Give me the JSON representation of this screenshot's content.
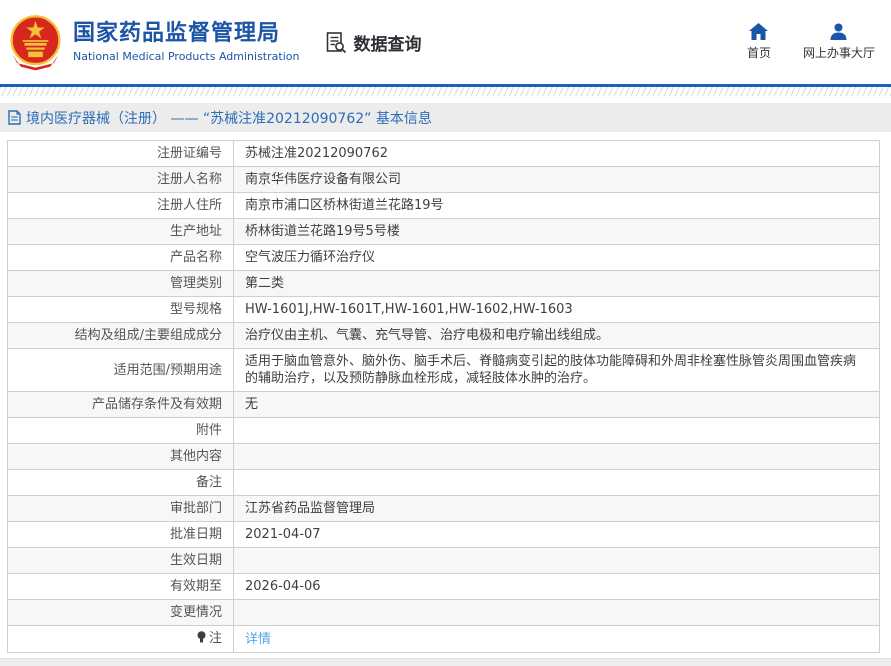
{
  "header": {
    "title": "国家药品监督管理局",
    "subtitle": "National Medical Products Administration",
    "nav_query": "数据查询",
    "nav_home": "首页",
    "nav_hall": "网上办事大厅"
  },
  "breadcrumb": {
    "text": "境内医疗器械（注册） —— “苏械注准20212090762” 基本信息"
  },
  "table": {
    "rows": [
      {
        "label": "注册证编号",
        "value": "苏械注准20212090762"
      },
      {
        "label": "注册人名称",
        "value": "南京华伟医疗设备有限公司"
      },
      {
        "label": "注册人住所",
        "value": "南京市浦口区桥林街道兰花路19号"
      },
      {
        "label": "生产地址",
        "value": "桥林街道兰花路19号5号楼"
      },
      {
        "label": "产品名称",
        "value": "空气波压力循环治疗仪"
      },
      {
        "label": "管理类别",
        "value": "第二类"
      },
      {
        "label": "型号规格",
        "value": "HW-1601J,HW-1601T,HW-1601,HW-1602,HW-1603"
      },
      {
        "label": "结构及组成/主要组成成分",
        "value": "治疗仪由主机、气囊、充气导管、治疗电极和电疗输出线组成。"
      },
      {
        "label": "适用范围/预期用途",
        "value": "适用于脑血管意外、脑外伤、脑手术后、脊髓病变引起的肢体功能障碍和外周非栓塞性脉管炎周围血管疾病的辅助治疗，以及预防静脉血栓形成，减轻肢体水肿的治疗。"
      },
      {
        "label": "产品储存条件及有效期",
        "value": "无"
      },
      {
        "label": "附件",
        "value": ""
      },
      {
        "label": "其他内容",
        "value": ""
      },
      {
        "label": "备注",
        "value": ""
      },
      {
        "label": "审批部门",
        "value": "江苏省药品监督管理局"
      },
      {
        "label": "批准日期",
        "value": "2021-04-07"
      },
      {
        "label": "生效日期",
        "value": ""
      },
      {
        "label": "有效期至",
        "value": "2026-04-06"
      },
      {
        "label": "变更情况",
        "value": ""
      },
      {
        "label": "注",
        "value": "详情",
        "link": true,
        "icon": "bulb-icon"
      }
    ]
  },
  "colors": {
    "brand_blue": "#1d55a6",
    "accent_line_blue": "#1a62b3",
    "breadcrumb_blue": "#2e6cb8",
    "link_blue": "#52a8e8",
    "emblem_red": "#d6281e",
    "emblem_gold": "#f3c237"
  }
}
